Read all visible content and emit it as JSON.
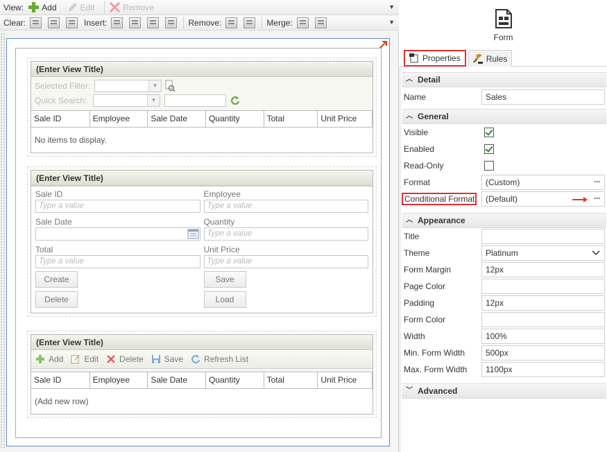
{
  "toolbar": {
    "view_label": "View:",
    "add": "Add",
    "edit": "Edit",
    "remove": "Remove",
    "clear_label": "Clear:",
    "insert_label": "Insert:",
    "remove_label": "Remove:",
    "merge_label": "Merge:"
  },
  "view1": {
    "title": "(Enter View Title)",
    "selected_filter_label": "Selected Filter:",
    "quick_search_label": "Quick Search:",
    "columns": [
      "Sale ID",
      "Employee",
      "Sale Date",
      "Quantity",
      "Total",
      "Unit Price"
    ],
    "empty_text": "No items to display."
  },
  "view2": {
    "title": "(Enter View Title)",
    "fields": {
      "sale_id": "Sale ID",
      "employee": "Employee",
      "sale_date": "Sale Date",
      "quantity": "Quantity",
      "total": "Total",
      "unit_price": "Unit Price"
    },
    "placeholder": "Type a value",
    "buttons": {
      "create": "Create",
      "save": "Save",
      "delete": "Delete",
      "load": "Load"
    }
  },
  "view3": {
    "title": "(Enter View Title)",
    "toolbar": {
      "add": "Add",
      "edit": "Edit",
      "delete": "Delete",
      "save": "Save",
      "refresh": "Refresh List"
    },
    "columns": [
      "Sale ID",
      "Employee",
      "Sale Date",
      "Quantity",
      "Total",
      "Unit Price"
    ],
    "new_row_text": "(Add new row)"
  },
  "panel": {
    "header_label": "Form",
    "tabs": {
      "properties": "Properties",
      "rules": "Rules"
    },
    "sections": {
      "detail": "Detail",
      "general": "General",
      "appearance": "Appearance",
      "advanced": "Advanced"
    },
    "detail": {
      "name_label": "Name",
      "name_value": "Sales"
    },
    "general": {
      "visible_label": "Visible",
      "visible": true,
      "enabled_label": "Enabled",
      "enabled": true,
      "readonly_label": "Read-Only",
      "readonly": false,
      "format_label": "Format",
      "format_value": "(Custom)",
      "cond_format_label": "Conditional Format",
      "cond_format_value": "(Default)",
      "ellipsis": "···"
    },
    "appearance": {
      "title_label": "Title",
      "title_value": "",
      "theme_label": "Theme",
      "theme_value": "Platinum",
      "form_margin_label": "Form Margin",
      "form_margin_value": "12px",
      "page_color_label": "Page Color",
      "page_color_value": "",
      "padding_label": "Padding",
      "padding_value": "12px",
      "form_color_label": "Form Color",
      "form_color_value": "",
      "width_label": "Width",
      "width_value": "100%",
      "min_width_label": "Min. Form Width",
      "min_width_value": "500px",
      "max_width_label": "Max. Form Width",
      "max_width_value": "1100px"
    }
  },
  "colors": {
    "highlight": "#e02f2f",
    "check": "#2f8a2f",
    "canvas_border": "#5b8fc9"
  }
}
